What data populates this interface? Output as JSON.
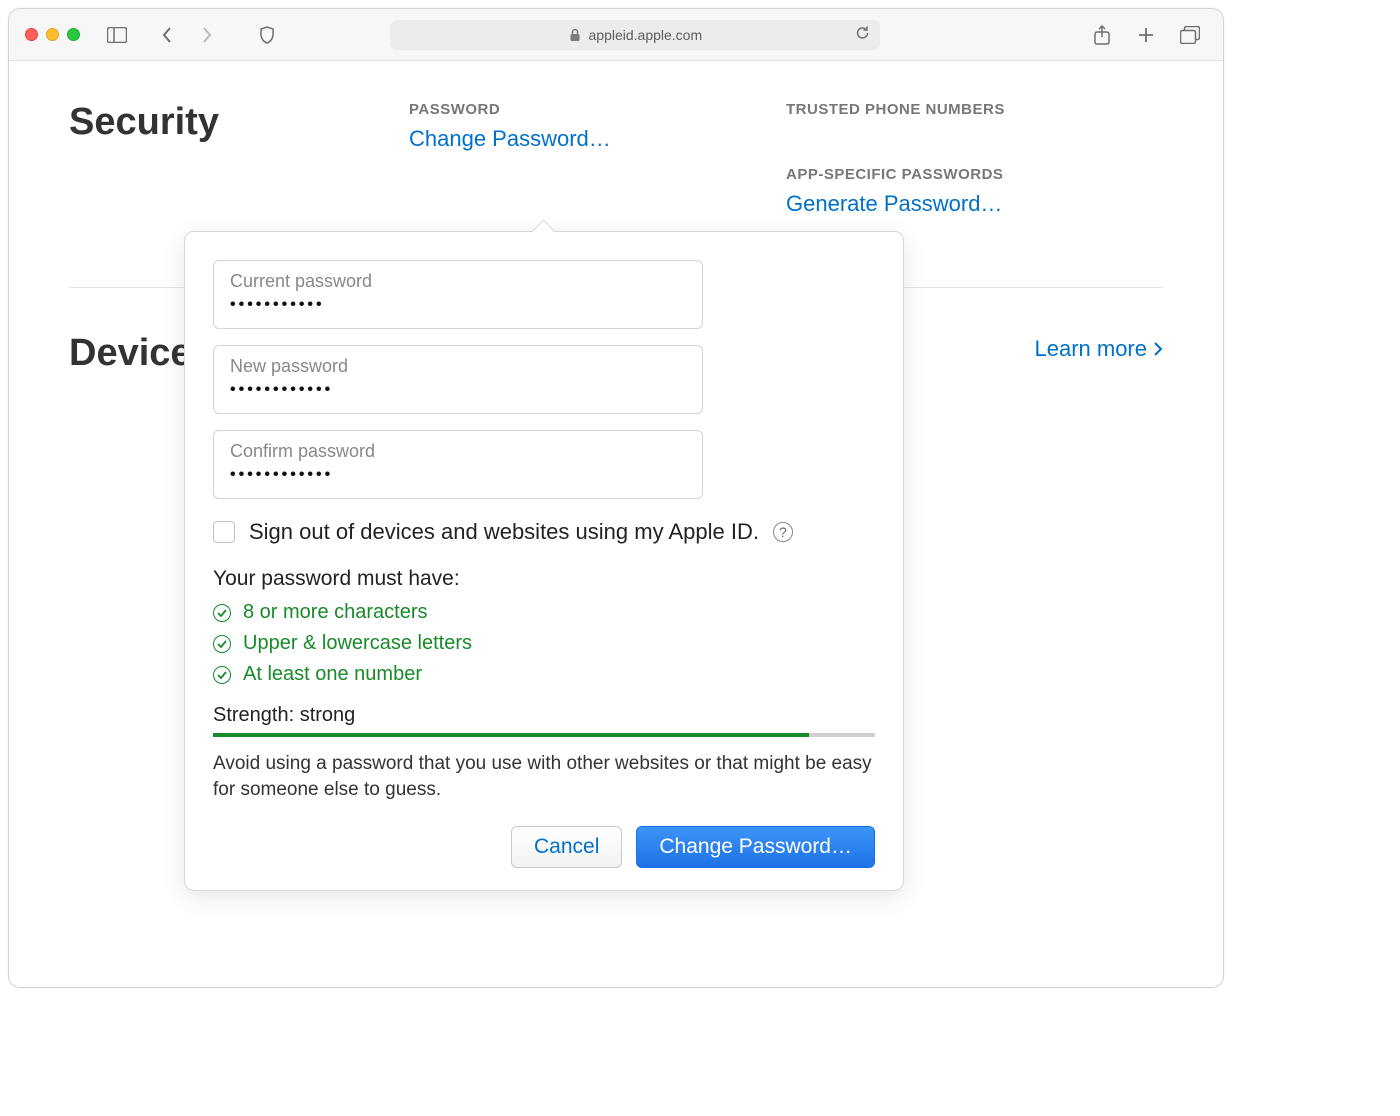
{
  "browser": {
    "url_host": "appleid.apple.com"
  },
  "page": {
    "section_security": "Security",
    "section_devices": "Devices",
    "password_heading": "PASSWORD",
    "change_password_link": "Change Password…",
    "trusted_heading": "TRUSTED PHONE NUMBERS",
    "app_specific_heading": "APP-SPECIFIC PASSWORDS",
    "generate_password_link": "Generate Password…",
    "learn_more": "Learn more"
  },
  "popover": {
    "fields": {
      "current_label": "Current password",
      "current_value": "•••••••••••",
      "new_label": "New password",
      "new_value": "••••••••••••",
      "confirm_label": "Confirm password",
      "confirm_value": "••••••••••••"
    },
    "signout_label": "Sign out of devices and websites using my Apple ID.",
    "requirements_title": "Your password must have:",
    "req1": "8 or more characters",
    "req2": "Upper & lowercase letters",
    "req3": "At least one number",
    "strength_label": "Strength: strong",
    "strength_percent": 90,
    "advice": "Avoid using a password that you use with other websites or that might be easy for someone else to guess.",
    "cancel": "Cancel",
    "submit": "Change Password…"
  }
}
